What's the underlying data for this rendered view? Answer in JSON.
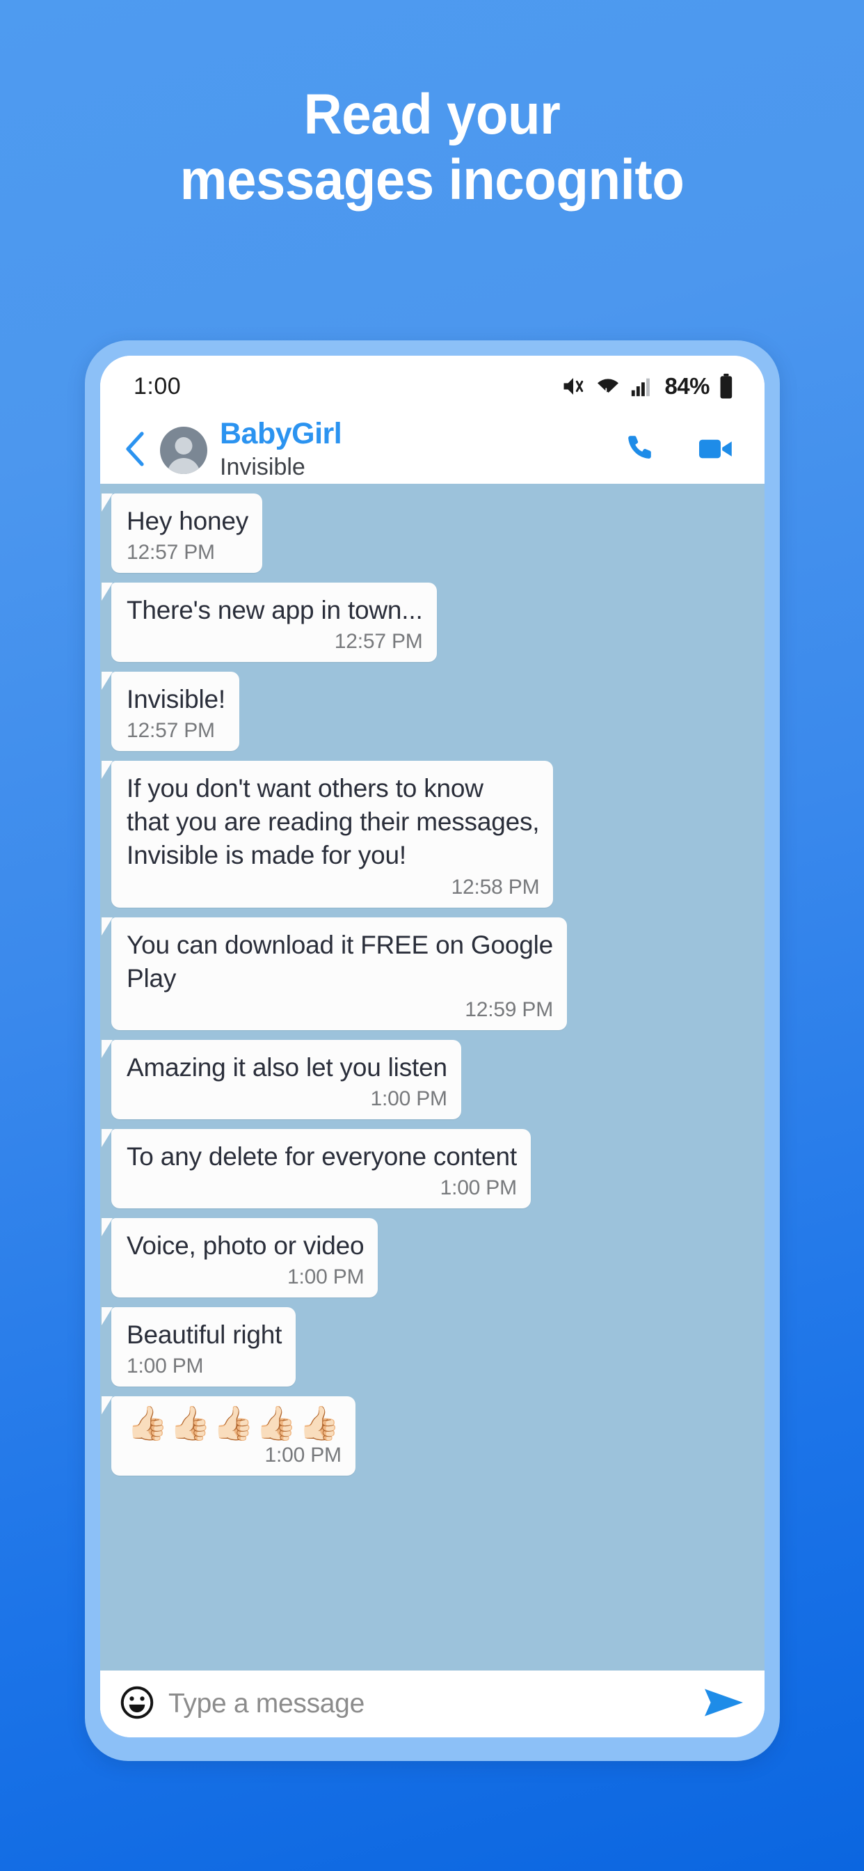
{
  "headline": {
    "line1": "Read your",
    "line2": "messages incognito",
    "color": "#FFFFFF"
  },
  "background": {
    "gradient_from": "#4E9BF0",
    "gradient_to": "#0B66E0"
  },
  "device": {
    "frame_color": "#8CC0F7",
    "screen_bg": "#FFFFFF"
  },
  "status_bar": {
    "time": "1:00",
    "battery_percent": "84%",
    "icons": [
      "mute-icon",
      "wifi-icon",
      "signal-icon",
      "battery-icon"
    ]
  },
  "chat_header": {
    "back_icon": "chevron-left-icon",
    "avatar_icon": "person-avatar-icon",
    "name": "BabyGirl",
    "name_color": "#2B93F0",
    "subtitle": "Invisible",
    "call_icon": "phone-icon",
    "video_icon": "video-camera-icon"
  },
  "chat": {
    "background_color": "#9CC2DB",
    "bubble_color": "#FCFCFC",
    "messages": [
      {
        "text": "Hey honey",
        "time": "12:57 PM",
        "width": "short",
        "type": "text"
      },
      {
        "text": "There's new app in town...",
        "time": "12:57 PM",
        "width": "wide",
        "type": "text"
      },
      {
        "text": "Invisible!",
        "time": "12:57 PM",
        "width": "short",
        "type": "text"
      },
      {
        "text": "If you don't want others to know\nthat you are reading their messages,\nInvisible is made for you!",
        "time": "12:58 PM",
        "width": "wide",
        "type": "text"
      },
      {
        "text": "You can download it FREE on Google\nPlay",
        "time": "12:59 PM",
        "width": "wide",
        "type": "text"
      },
      {
        "text": "Amazing it also let you listen",
        "time": "1:00 PM",
        "width": "wide",
        "type": "text"
      },
      {
        "text": "To any delete for everyone content",
        "time": "1:00 PM",
        "width": "wide",
        "type": "text"
      },
      {
        "text": "Voice, photo or video",
        "time": "1:00 PM",
        "width": "wide",
        "type": "text"
      },
      {
        "text": "Beautiful right",
        "time": "1:00 PM",
        "width": "short",
        "type": "text"
      },
      {
        "text": "👍🏻👍🏻👍🏻👍🏻👍🏻",
        "time": "1:00 PM",
        "width": "short",
        "type": "emoji"
      }
    ]
  },
  "input_bar": {
    "emoji_icon": "smiley-face-icon",
    "placeholder": "Type a message",
    "value": "",
    "send_icon": "send-arrow-icon",
    "send_color": "#1E8CE8"
  }
}
